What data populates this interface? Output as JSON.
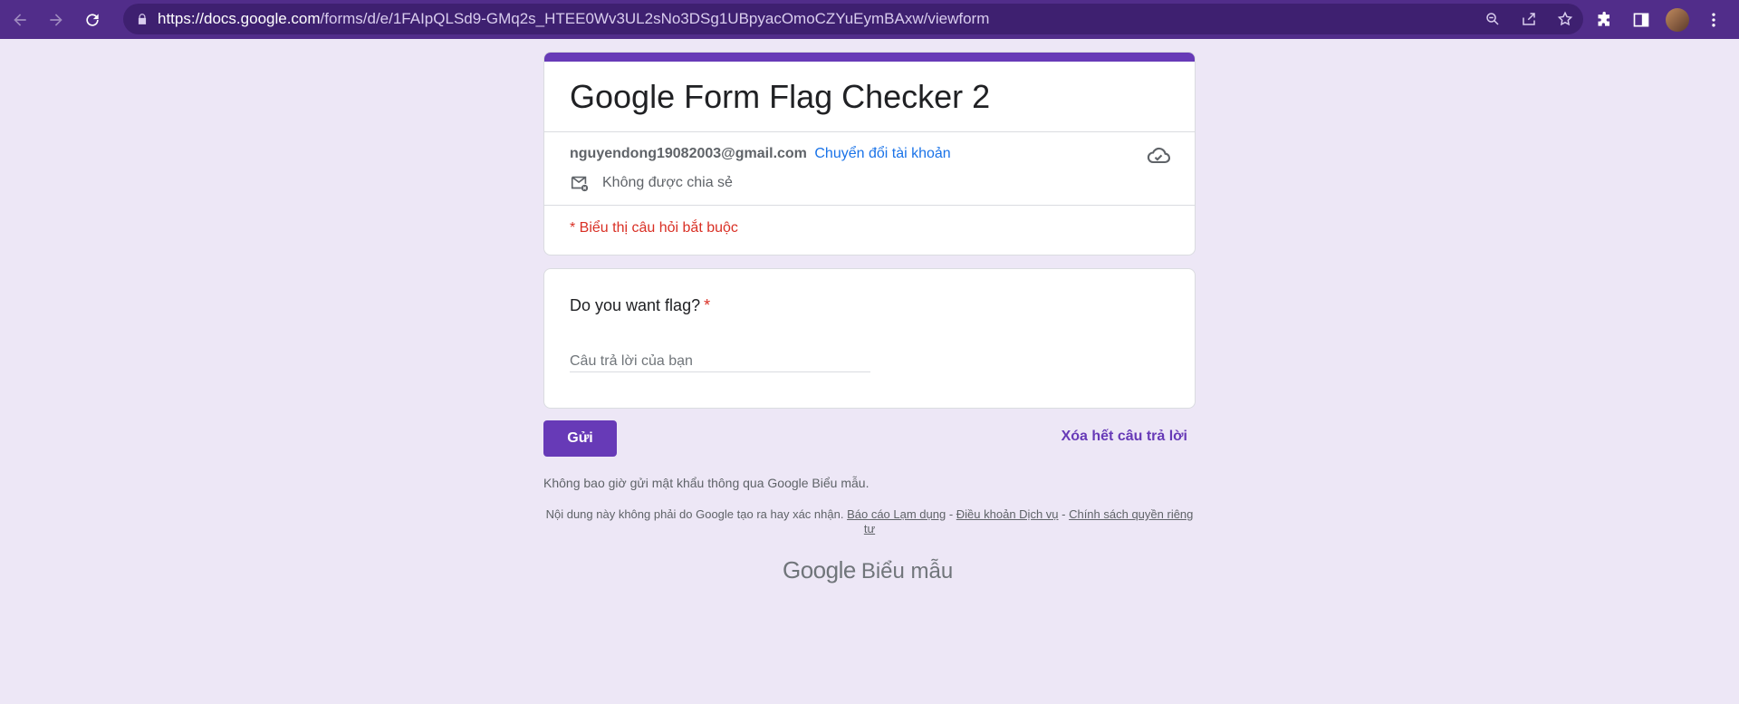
{
  "browser": {
    "url_host": "https://docs.google.com",
    "url_path": "/forms/d/e/1FAIpQLSd9-GMq2s_HTEE0Wv3UL2sNo3DSg1UBpyacOmoCZYuEymBAxw/viewform"
  },
  "form": {
    "title": "Google Form Flag Checker 2",
    "account_email": "nguyendong19082003@gmail.com",
    "switch_account": "Chuyển đổi tài khoản",
    "not_shared": "Không được chia sẻ",
    "required_note": "* Biểu thị câu hỏi bắt buộc"
  },
  "question": {
    "title": "Do you want flag?",
    "required_mark": "*",
    "placeholder": "Câu trả lời của bạn"
  },
  "actions": {
    "submit": "Gửi",
    "clear": "Xóa hết câu trả lời"
  },
  "footer": {
    "password_note": "Không bao giờ gửi mật khẩu thông qua Google Biểu mẫu.",
    "disclaimer_text": "Nội dung này không phải do Google tạo ra hay xác nhận.",
    "report_abuse": "Báo cáo Lạm dụng",
    "terms": "Điều khoản Dịch vụ",
    "privacy": "Chính sách quyền riêng tư",
    "sep": " - ",
    "brand_google": "Google",
    "brand_product": "Biểu mẫu"
  },
  "colors": {
    "accent": "#673ab7",
    "required": "#d93025",
    "link": "#1a73e8",
    "background": "#ede7f6"
  },
  "icons": [
    "back-icon",
    "forward-icon",
    "reload-icon",
    "lock-icon",
    "zoom-icon",
    "share-icon",
    "star-icon",
    "extensions-icon",
    "side-panel-icon",
    "menu-icon",
    "cloud-check-icon",
    "mail-off-icon"
  ]
}
